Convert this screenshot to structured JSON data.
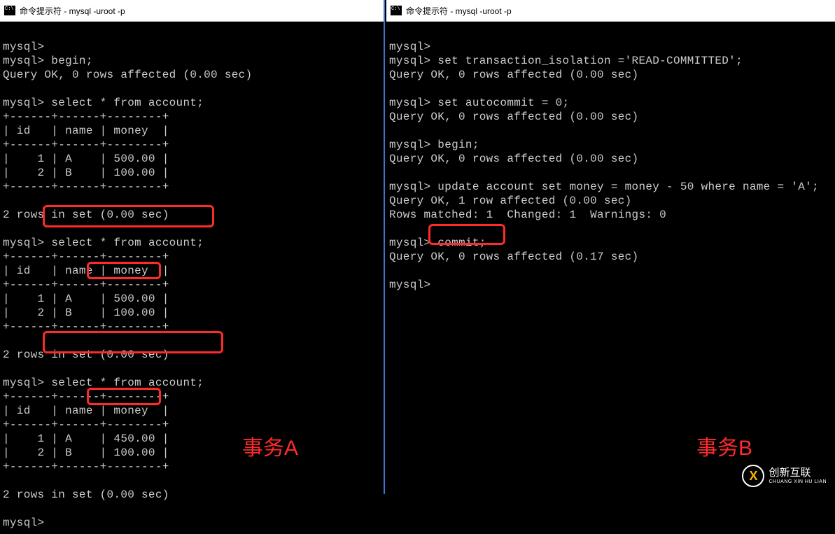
{
  "left": {
    "title": "命令提示符 - mysql  -uroot -p",
    "prompt": "mysql>",
    "lines": {
      "l1": "mysql>",
      "begin": "mysql> begin;",
      "ok0": "Query OK, 0 rows affected (0.00 sec)",
      "sel1": "mysql> select * from account;",
      "tblTop": "+------+------+--------+",
      "tblHdr": "| id   | name | money  |",
      "r1a": "|    1 | A    | 500.00 |",
      "r2a": "|    2 | B    | 100.00 |",
      "rows2": "2 rows in set (0.00 sec)",
      "promptOnly": "mysql>",
      "sel2text": " select * from account;",
      "r1c": "|    1 | A    | 450.00 |",
      "r2c": "|    2 | B    | 100.00 |",
      "finalPrompt": "mysql>"
    },
    "annot_label": "事务A"
  },
  "right": {
    "title": "命令提示符 - mysql  -uroot -p",
    "lines": {
      "p0": "mysql>",
      "setiso": "mysql> set transaction_isolation ='READ-COMMITTED';",
      "ok0": "Query OK, 0 rows affected (0.00 sec)",
      "setauto": "mysql> set autocommit = 0;",
      "begin": "mysql> begin;",
      "update": "mysql> update account set money = money - 50 where name = 'A';",
      "ok1": "Query OK, 1 row affected (0.00 sec)",
      "matched": "Rows matched: 1  Changed: 1  Warnings: 0",
      "commitPrompt": "mysql>",
      "commitText": " commit;",
      "ok017": "Query OK, 0 rows affected (0.17 sec)",
      "final": "mysql>"
    },
    "annot_label": "事务B"
  },
  "watermark": {
    "cn": "创新互联",
    "en": "CHUANG XIN HU LIAN"
  },
  "annotation_boxes": {
    "left_select_1": "select * from account;",
    "left_value_500": "500.00",
    "left_select_2": "select * from account;",
    "left_value_450": "450.00",
    "right_commit": "commit;"
  }
}
